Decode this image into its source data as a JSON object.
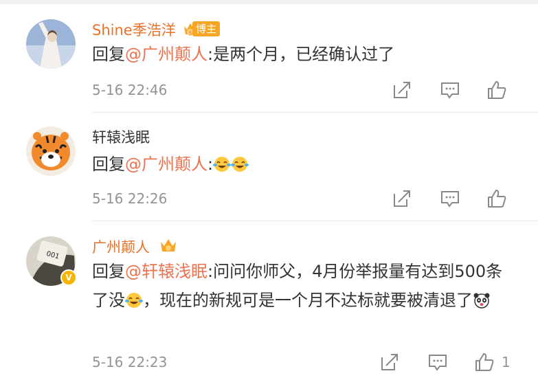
{
  "comments": [
    {
      "username": "Shine季浩洋",
      "badge": "博主",
      "reply_prefix": "回复",
      "mention": "@广州颠人",
      "text": ":是两个月，已经确认过了",
      "time": "5-16 22:46"
    },
    {
      "username": "轩辕浅眠",
      "reply_prefix": "回复",
      "mention": "@广州颠人",
      "text": ":",
      "emojis": [
        "laugh-cry-emoji",
        "laugh-cry-emoji"
      ],
      "time": "5-16 22:26"
    },
    {
      "username": "广州颠人",
      "reply_prefix": "回复",
      "mention": "@轩辕浅眠",
      "text_part1": ":问问你师父，4月份举报量有达到500条了没",
      "text_part2": "，现在的新规可是一个月不达标就要被清退了",
      "emojis": [
        "laugh-cry-emoji",
        "panda-emoji"
      ],
      "time": "5-16 22:23",
      "like_count": "1",
      "verified_mark": "V"
    }
  ],
  "icons": {
    "share": "share-icon",
    "comment": "comment-icon",
    "like": "like-icon"
  },
  "colors": {
    "mention": "#eb7350",
    "vip_name": "#e8722a",
    "meta": "#939393",
    "badge": "#f6a623"
  }
}
